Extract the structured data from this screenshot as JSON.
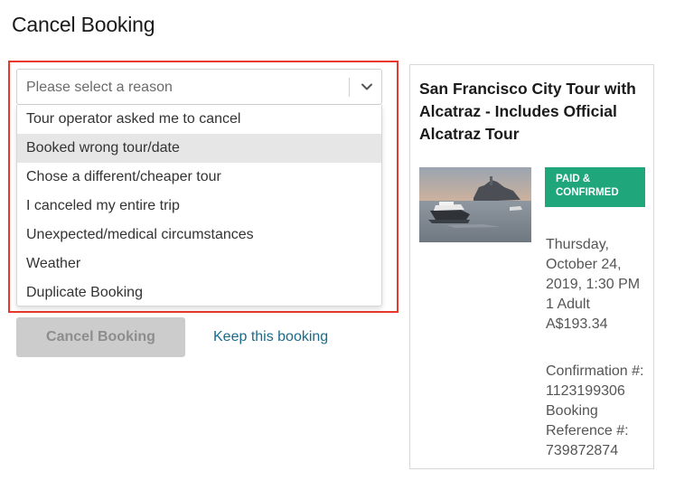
{
  "page": {
    "title": "Cancel Booking"
  },
  "reason_select": {
    "placeholder": "Please select a reason",
    "icon": "chevron-down-icon",
    "options": [
      "Tour operator asked me to cancel",
      "Booked wrong tour/date",
      "Chose a different/cheaper tour",
      "I canceled my entire trip",
      "Unexpected/medical circumstances",
      "Weather",
      "Duplicate Booking"
    ],
    "hovered_option": "Booked wrong tour/date"
  },
  "actions": {
    "cancel_label": "Cancel Booking",
    "keep_label": "Keep this booking"
  },
  "booking": {
    "tour_title": "San Francisco City Tour with Alcatraz - Includes Official Alcatraz Tour",
    "status": "PAID & CONFIRMED",
    "date": "Thursday, October 24, 2019, 1:30 PM",
    "travelers": "1 Adult",
    "price": "A$193.34",
    "confirmation": "Confirmation #: 1123199306",
    "reference": "Booking Reference #: 739872874"
  },
  "colors": {
    "highlight": "#e8382b",
    "status_badge": "#1fa67a",
    "link": "#1a6b8a",
    "disabled_button": "#cccccc"
  }
}
